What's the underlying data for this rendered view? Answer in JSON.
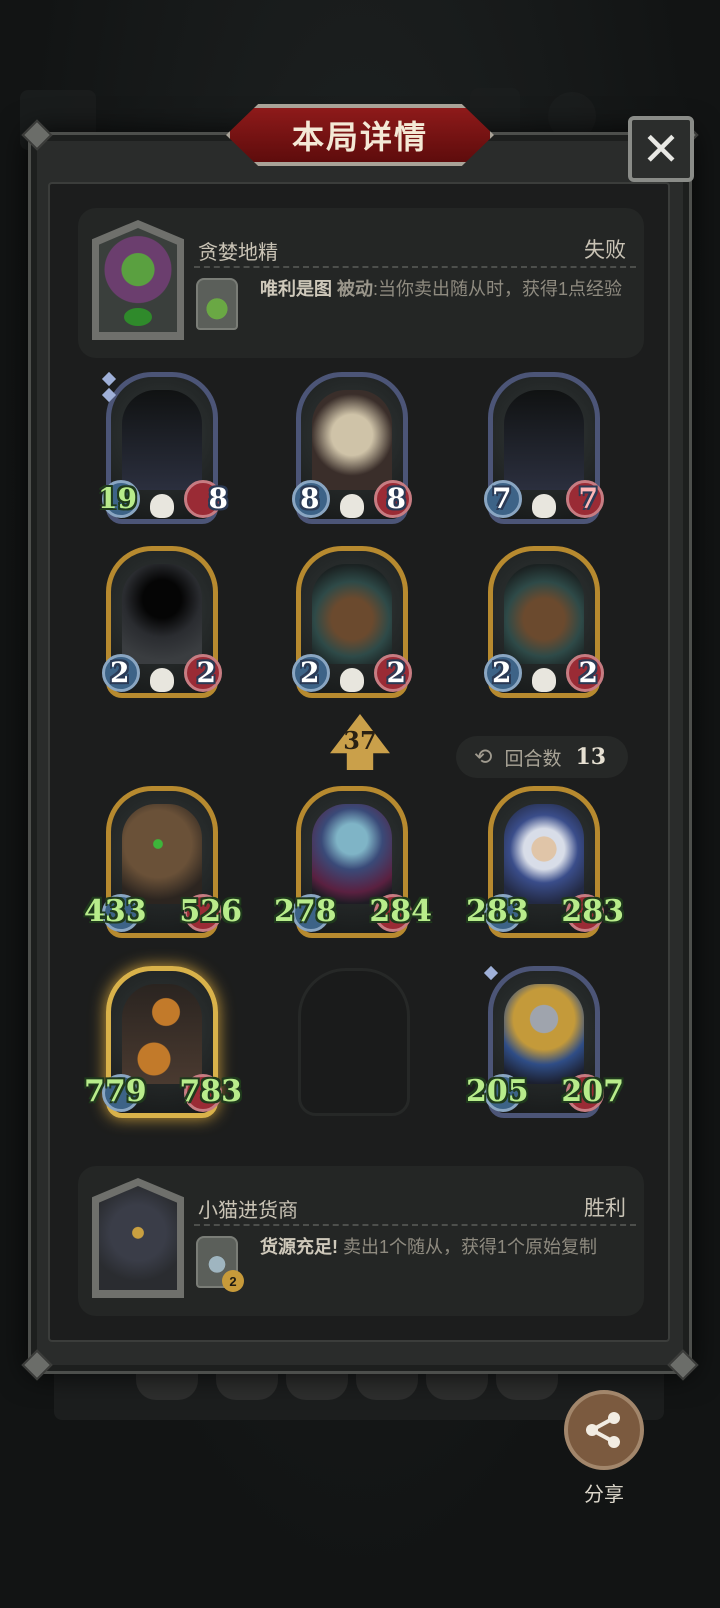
{
  "title": "本局详情",
  "close_label": "✕",
  "opponent": {
    "name": "贪婪地精",
    "result": "失败",
    "skill_name": "唯利是图",
    "skill_type": "被动",
    "skill_desc": ":当你卖出随从时，获得1点经验"
  },
  "board_top": [
    {
      "atk": "19",
      "hp": "8"
    },
    {
      "atk": "8",
      "hp": "8"
    },
    {
      "atk": "7",
      "hp": "7"
    },
    {
      "atk": "2",
      "hp": "2"
    },
    {
      "atk": "2",
      "hp": "2"
    },
    {
      "atk": "2",
      "hp": "2"
    }
  ],
  "level": "37",
  "round": {
    "label": "回合数",
    "value": "13"
  },
  "board_bottom": [
    {
      "atk": "433",
      "hp": "526"
    },
    {
      "atk": "278",
      "hp": "284"
    },
    {
      "atk": "283",
      "hp": "283"
    },
    {
      "atk": "779",
      "hp": "783"
    },
    {
      "atk": "205",
      "hp": "207"
    }
  ],
  "player": {
    "name": "小猫进货商",
    "result": "胜利",
    "skill_name": "货源充足!",
    "skill_desc": " 卖出1个随从，获得1个原始复制",
    "skill_cost": "2"
  },
  "share_label": "分享",
  "colors": {
    "banner": "#8e1a1a",
    "gold_frame": "#b78a2f",
    "blue_frame": "#4c5577",
    "stat_green": "#b8ec8b"
  }
}
